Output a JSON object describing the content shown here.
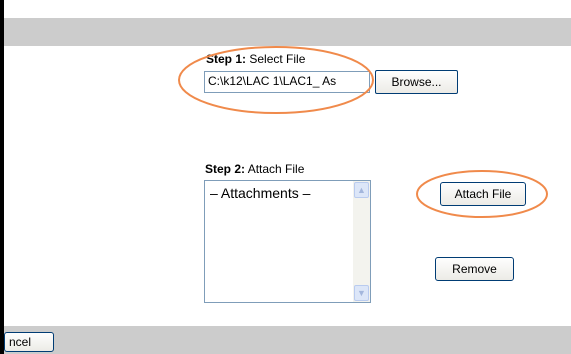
{
  "step1": {
    "title": "Step 1:",
    "label": "Select File",
    "file_value": "C:\\k12\\LAC 1\\LAC1_ As",
    "browse_label": "Browse..."
  },
  "step2": {
    "title": "Step 2:",
    "label": "Attach File",
    "list_item": "– Attachments –",
    "attach_label": "Attach File",
    "remove_label": "Remove"
  },
  "footer": {
    "cancel_label": "ncel"
  },
  "colors": {
    "band": "#cccccc",
    "highlight": "#f08a4b",
    "button_border": "#003c74",
    "input_border": "#7f9db9"
  }
}
